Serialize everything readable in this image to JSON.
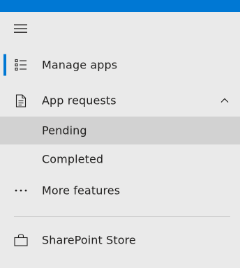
{
  "nav": {
    "items": [
      {
        "label": "Manage apps",
        "icon": "list-bullets-icon"
      },
      {
        "label": "App requests",
        "icon": "document-icon",
        "expanded": true,
        "children": [
          {
            "label": "Pending"
          },
          {
            "label": "Completed"
          }
        ]
      },
      {
        "label": "More features",
        "icon": "more-ellipsis-icon"
      },
      {
        "label": "SharePoint Store",
        "icon": "shopping-bag-icon"
      }
    ]
  },
  "colors": {
    "accent": "#0078d4",
    "background": "#eaeaea",
    "active_background": "#d2d2d2",
    "text": "#201f1e"
  }
}
